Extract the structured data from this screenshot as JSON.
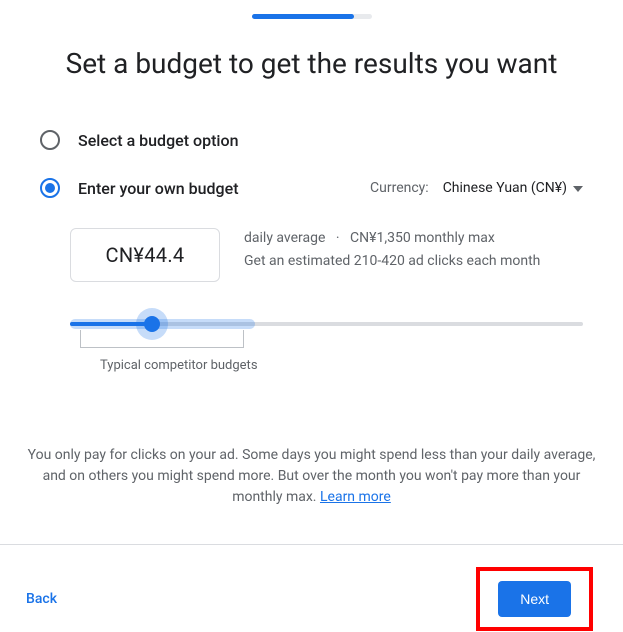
{
  "title": "Set a budget to get the results you want",
  "options": {
    "select_option_label": "Select a budget option",
    "enter_own_label": "Enter your own budget"
  },
  "currency": {
    "label": "Currency:",
    "value": "Chinese Yuan (CN¥)"
  },
  "budget": {
    "amount": "CN¥44.4",
    "daily_average_label": "daily average",
    "separator": "·",
    "monthly_max": "CN¥1,350 monthly max",
    "clicks_estimate": "Get an estimated 210-420 ad clicks each month"
  },
  "slider": {
    "typical_label": "Typical competitor budgets"
  },
  "disclaimer": {
    "text": "You only pay for clicks on your ad. Some days you might spend less than your daily average, and on others you might spend more. But over the month you won't pay more than your monthly max. ",
    "learn_more": "Learn more"
  },
  "footer": {
    "back": "Back",
    "next": "Next"
  }
}
